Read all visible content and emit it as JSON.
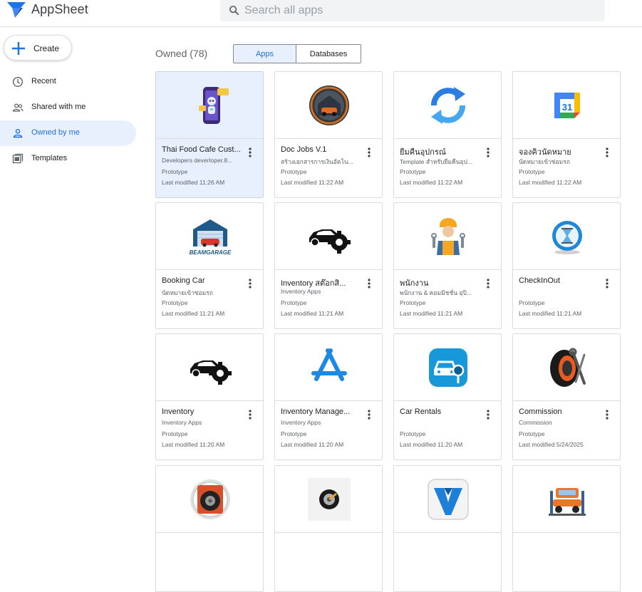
{
  "header": {
    "brand": "AppSheet",
    "search_placeholder": "Search all apps"
  },
  "sidebar": {
    "create_label": "Create",
    "items": [
      {
        "label": "Recent",
        "icon": "clock-icon"
      },
      {
        "label": "Shared with me",
        "icon": "people-icon"
      },
      {
        "label": "Owned by me",
        "icon": "person-icon",
        "active": true
      },
      {
        "label": "Templates",
        "icon": "templates-icon"
      }
    ]
  },
  "main": {
    "owned_title": "Owned (78)",
    "tabs": [
      {
        "label": "Apps",
        "selected": true
      },
      {
        "label": "Databases",
        "selected": false
      }
    ]
  },
  "apps": [
    {
      "title": "Thai Food Cafe Cust...",
      "subtitle": "Developers deverloper.8...",
      "status": "Prototype",
      "modified": "Last modified 11:26 AM",
      "icon": "robot-phone-icon",
      "selected": true
    },
    {
      "title": "Doc Jobs V.1",
      "subtitle": "สร้างเอกสารการเงินอัตโน...",
      "status": "Prototype",
      "modified": "Last modified 11:22 AM",
      "icon": "garage-circle-icon"
    },
    {
      "title": "ยืมคืนอุปกรณ์",
      "subtitle": "Template สำหรับยืมคืนอุป...",
      "status": "Prototype",
      "modified": "Last modified 11:22 AM",
      "icon": "sync-arrows-icon"
    },
    {
      "title": "จองคิวนัดหมาย",
      "subtitle": "นัดหมายเข้าซ่อมรถ",
      "status": "Prototype",
      "modified": "Last modified 11:22 AM",
      "icon": "google-calendar-icon"
    },
    {
      "title": "Booking Car",
      "subtitle": "นัดหมายเข้าซ่อมรถ",
      "status": "Prototype",
      "modified": "Last modified 11:21 AM",
      "icon": "beam-garage-icon",
      "logo_text": "BEAMGARAGE"
    },
    {
      "title": "Inventory สต๊อกสิ...",
      "subtitle": "Inventory Apps",
      "status": "Prototype",
      "modified": "Last modified 11:21 AM",
      "icon": "car-gear-icon"
    },
    {
      "title": "พนักงาน",
      "subtitle": "พนักงาน & คอมมิชชั่น อุปิ...",
      "status": "Prototype",
      "modified": "Last modified 11:21 AM",
      "icon": "mechanic-icon"
    },
    {
      "title": "CheckInOut",
      "subtitle": "",
      "status": "Prototype",
      "modified": "Last modified 11:21 AM",
      "icon": "hourglass-icon"
    },
    {
      "title": "Inventory",
      "subtitle": "Inventory Apps",
      "status": "Prototype",
      "modified": "Last modified 11:20 AM",
      "icon": "car-gear-icon"
    },
    {
      "title": "Inventory Manage...",
      "subtitle": "Inventory Apps",
      "status": "Prototype",
      "modified": "Last modified 11:20 AM",
      "icon": "app-store-icon"
    },
    {
      "title": "Car Rentals",
      "subtitle": "",
      "status": "Prototype",
      "modified": "Last modified 11:20 AM",
      "icon": "car-key-icon"
    },
    {
      "title": "Commission",
      "subtitle": "Commission",
      "status": "Prototype",
      "modified": "Last modified 5/24/2025",
      "icon": "tire-wrench-icon"
    },
    {
      "title": "",
      "subtitle": "",
      "status": "",
      "modified": "",
      "icon": "garage-tire-icon"
    },
    {
      "title": "",
      "subtitle": "",
      "status": "",
      "modified": "",
      "icon": "wheel-icon"
    },
    {
      "title": "",
      "subtitle": "",
      "status": "",
      "modified": "",
      "icon": "v-logo-icon"
    },
    {
      "title": "",
      "subtitle": "",
      "status": "",
      "modified": "",
      "icon": "car-lift-icon"
    }
  ],
  "colors": {
    "accent": "#1a73e8",
    "selected_bg": "#e8f0fe"
  }
}
